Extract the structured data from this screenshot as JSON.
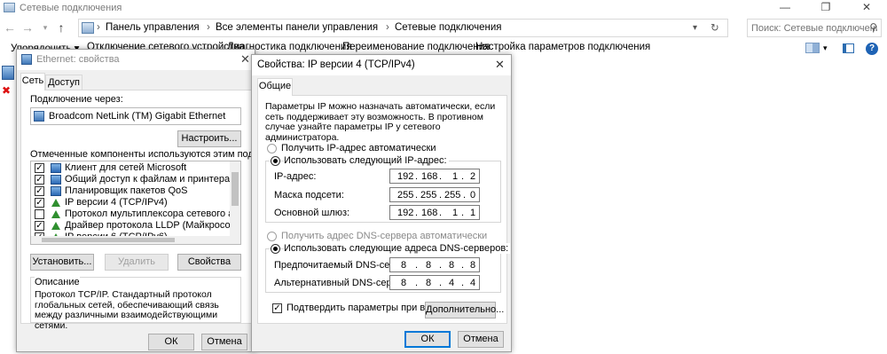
{
  "window": {
    "title": "Сетевые подключения",
    "controls": {
      "minimize": "—",
      "maximize": "❐",
      "close": "✕"
    }
  },
  "address": {
    "segments": [
      "Панель управления",
      "Все элементы панели управления",
      "Сетевые подключения"
    ],
    "separator": "›",
    "search_placeholder": "Поиск: Сетевые подключения"
  },
  "commands": [
    "Упорядочить ▾",
    "Отключение сетевого устройства",
    "Диагностика подключения",
    "Переименование подключения",
    "Настройка параметров подключения"
  ],
  "ethernet_dialog": {
    "title": "Ethernet: свойства",
    "tabs": [
      "Сеть",
      "Доступ"
    ],
    "connect_via_label": "Подключение через:",
    "adapter_name": "Broadcom NetLink (TM) Gigabit Ethernet",
    "configure_button": "Настроить...",
    "components_label": "Отмеченные компоненты используются этим подключением:",
    "components": [
      {
        "label": "Клиент для сетей Microsoft",
        "checked": true,
        "icon": "network-client-icon"
      },
      {
        "label": "Общий доступ к файлам и принтерам для сетей Mi",
        "checked": true,
        "icon": "file-sharing-icon"
      },
      {
        "label": "Планировщик пакетов QoS",
        "checked": true,
        "icon": "qos-icon"
      },
      {
        "label": "IP версии 4 (TCP/IPv4)",
        "checked": true,
        "icon": "protocol-icon"
      },
      {
        "label": "Протокол мультиплексора сетевого адаптера (Ма",
        "checked": false,
        "icon": "protocol-icon"
      },
      {
        "label": "Драйвер протокола LLDP (Майкрософт)",
        "checked": true,
        "icon": "protocol-icon"
      },
      {
        "label": "IP версии 6 (TCP/IPv6)",
        "checked": true,
        "icon": "protocol-icon"
      }
    ],
    "install_button": "Установить...",
    "remove_button": "Удалить",
    "properties_button": "Свойства",
    "description_title": "Описание",
    "description_text": "Протокол TCP/IP. Стандартный протокол глобальных сетей, обеспечивающий связь между различными взаимодействующими сетями.",
    "ok_button": "ОК",
    "cancel_button": "Отмена"
  },
  "ipv4_dialog": {
    "title": "Свойства: IP версии 4 (TCP/IPv4)",
    "tab": "Общие",
    "intro": "Параметры IP можно назначать автоматически, если сеть поддерживает эту возможность. В противном случае узнайте параметры IP у сетевого администратора.",
    "auto_ip_label": "Получить IP-адрес автоматически",
    "manual_ip_label": "Использовать следующий IP-адрес:",
    "ip_mode": "manual",
    "ip_address_label": "IP-адрес:",
    "ip_address": [
      "192",
      "168",
      "1",
      "2"
    ],
    "subnet_label": "Маска подсети:",
    "subnet": [
      "255",
      "255",
      "255",
      "0"
    ],
    "gateway_label": "Основной шлюз:",
    "gateway": [
      "192",
      "168",
      "1",
      "1"
    ],
    "auto_dns_label": "Получить адрес DNS-сервера автоматически",
    "manual_dns_label": "Использовать следующие адреса DNS-серверов:",
    "dns_mode": "manual",
    "preferred_dns_label": "Предпочитаемый DNS-сервер:",
    "preferred_dns": [
      "8",
      "8",
      "8",
      "8"
    ],
    "alternate_dns_label": "Альтернативный DNS-сервер:",
    "alternate_dns": [
      "8",
      "8",
      "4",
      "4"
    ],
    "validate_label": "Подтвердить параметры при выходе",
    "validate_checked": true,
    "advanced_button": "Дополнительно...",
    "ok_button": "ОК",
    "cancel_button": "Отмена",
    "close_glyph": "✕"
  },
  "colors": {
    "accent": "#0078d7",
    "dialog_bg": "#f0f0f0",
    "border": "#adadad"
  }
}
